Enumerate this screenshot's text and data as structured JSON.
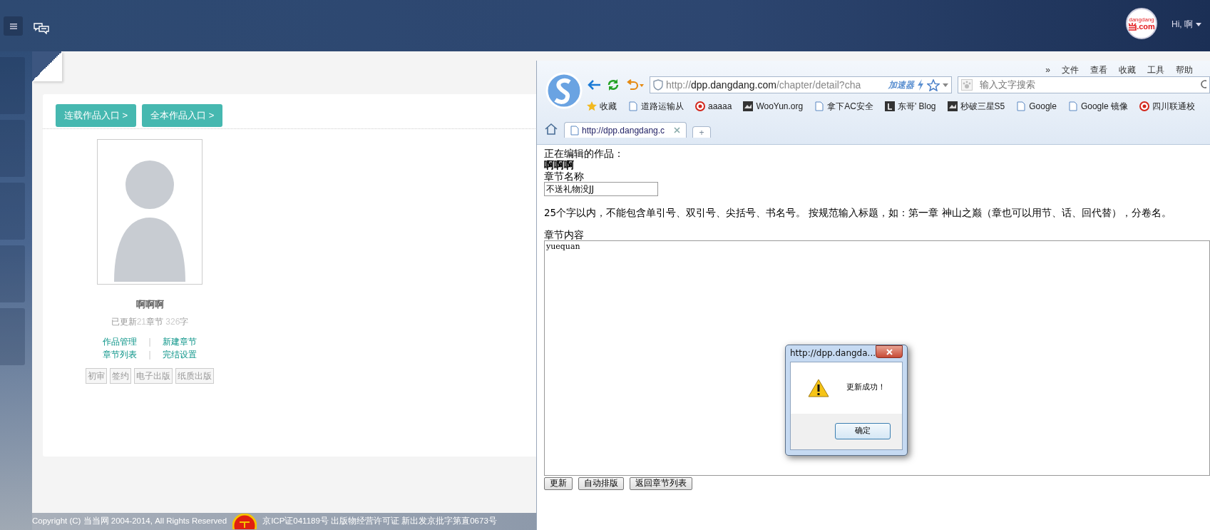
{
  "header": {
    "logo_text": ".com",
    "logo_small": "dangdang",
    "user_greeting": "Hi, 啊"
  },
  "entry_buttons": [
    "连载作品入口 >",
    "全本作品入口 >"
  ],
  "author": {
    "name": "啊啊啊",
    "stats": [
      {
        "kind": "label",
        "text": "已更新"
      },
      {
        "kind": "number",
        "text": "21"
      },
      {
        "kind": "label",
        "text": "章节 "
      },
      {
        "kind": "number",
        "text": "326"
      },
      {
        "kind": "label",
        "text": "字"
      }
    ],
    "link_rows": [
      {
        "links": [
          "作品管理",
          "新建章节"
        ],
        "separator": "|"
      },
      {
        "links": [
          "章节列表",
          "完结设置"
        ],
        "separator": "|"
      }
    ],
    "status_tags": [
      "初审",
      "签约",
      "电子出版",
      "纸质出版"
    ]
  },
  "footer": {
    "copyright": "Copyright (C) 当当网 2004-2014, All Rights Reserved",
    "license": "京ICP证041189号 出版物经营许可证 新出发京批字第直0673号"
  },
  "browser": {
    "menu": [
      "»",
      "文件",
      "查看",
      "收藏",
      "工具",
      "帮助"
    ],
    "address": {
      "scheme": "http://",
      "host": "dpp.dangdang.com",
      "path": "/chapter/detail?cha",
      "accelerator": "加速器"
    },
    "search": {
      "placeholder": "输入文字搜索"
    },
    "bookmarks": [
      {
        "kind": "star",
        "label": "收藏"
      },
      {
        "kind": "page",
        "label": "道路运输从"
      },
      {
        "kind": "badge",
        "label": "aaaaa"
      },
      {
        "kind": "dark",
        "label": "WooYun.org"
      },
      {
        "kind": "page",
        "label": "拿下AC安全"
      },
      {
        "kind": "letter",
        "label": "东哥' Blog"
      },
      {
        "kind": "dark",
        "label": "秒破三星S5"
      },
      {
        "kind": "page",
        "label": "Google"
      },
      {
        "kind": "page",
        "label": "Google 镜像"
      },
      {
        "kind": "badge",
        "label": "四川联通校"
      }
    ],
    "tabs": [
      {
        "title": "http://dpp.dangdang.c",
        "selected": true
      }
    ],
    "new_tab": "+",
    "page": {
      "editing_label": "正在编辑的作品：",
      "work_title": "啊啊啊",
      "chapter_name_label": "章节名称",
      "chapter_name_value": "不送礼物没JJ",
      "hint": "25个字以内，不能包含单引号、双引号、尖括号、书名号。 按规范输入标题，如：第一章 神山之巅（章也可以用节、话、回代替），分卷名。",
      "content_label": "章节内容",
      "content_value": "yuequan",
      "buttons": [
        "更新",
        "自动排版",
        "返回章节列表"
      ]
    },
    "dialog": {
      "title": "http://dpp.dangda...",
      "message": "更新成功！",
      "button": "确定"
    }
  }
}
